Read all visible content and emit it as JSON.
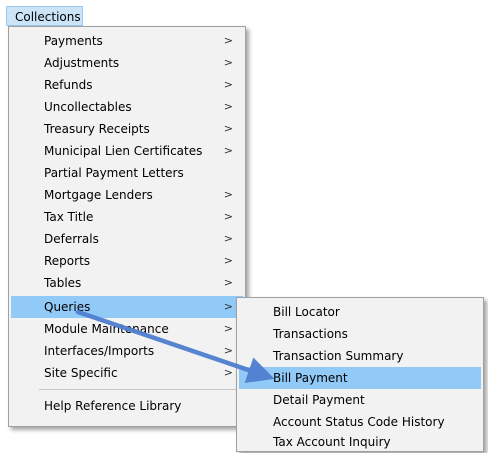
{
  "menubar": {
    "label": "Collections"
  },
  "main_menu": {
    "items": [
      {
        "label": "Payments",
        "has_submenu": true
      },
      {
        "label": "Adjustments",
        "has_submenu": true
      },
      {
        "label": "Refunds",
        "has_submenu": true
      },
      {
        "label": "Uncollectables",
        "has_submenu": true
      },
      {
        "label": "Treasury Receipts",
        "has_submenu": true
      },
      {
        "label": "Municipal Lien Certificates",
        "has_submenu": true
      },
      {
        "label": "Partial Payment Letters",
        "has_submenu": false
      },
      {
        "label": "Mortgage Lenders",
        "has_submenu": true
      },
      {
        "label": "Tax Title",
        "has_submenu": true
      },
      {
        "label": "Deferrals",
        "has_submenu": true
      },
      {
        "label": "Reports",
        "has_submenu": true
      },
      {
        "label": "Tables",
        "has_submenu": true
      },
      {
        "label": "Queries",
        "has_submenu": true,
        "selected": true
      },
      {
        "label": "Module Maintenance",
        "has_submenu": true
      },
      {
        "label": "Interfaces/Imports",
        "has_submenu": true
      },
      {
        "label": "Site Specific",
        "has_submenu": true
      },
      {
        "label": "Help Reference Library",
        "has_submenu": false
      }
    ],
    "submenu_arrow": ">"
  },
  "queries_submenu": {
    "items": [
      {
        "label": "Bill Locator"
      },
      {
        "label": "Transactions"
      },
      {
        "label": "Transaction Summary"
      },
      {
        "label": "Bill Payment",
        "selected": true
      },
      {
        "label": "Detail Payment"
      },
      {
        "label": "Account Status Code History"
      },
      {
        "label": "Tax Account Inquiry"
      }
    ]
  },
  "colors": {
    "menu_background": "#f2f2f2",
    "highlight": "#91c9f7",
    "menubar_highlight": "#cce4f7",
    "annotation_arrow": "#4f7fd0"
  }
}
